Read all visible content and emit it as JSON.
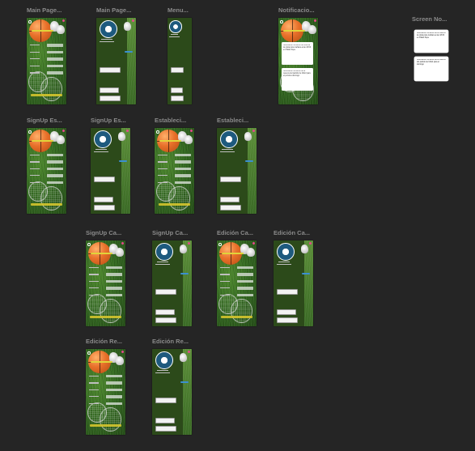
{
  "canvas": {
    "background": "#252525"
  },
  "frames": [
    {
      "title": "Main Page...",
      "variant": "hero"
    },
    {
      "title": "Main Page...",
      "variant": "profile"
    },
    {
      "title": "Menu...",
      "variant": "menu"
    },
    {
      "title": "Notificacio...",
      "variant": "notifications",
      "cards": [
        "Notificación recuerdo de reserva de pista para mañana a las 18:00 en Pádel Pepe",
        "Notificación recuerdo de la reserva del partido de fútbol para el próximo domingo"
      ]
    },
    {
      "title": "Screen No...",
      "variant": "notes",
      "notes": [
        "Notificación recuerdo de la reserva de pista para mañana a las 18:00 en Pádel Pepe",
        "Notificación recuerdo de la reserva del partido de fútbol para el domingo"
      ]
    },
    {
      "title": "SignUp Es...",
      "variant": "hero"
    },
    {
      "title": "SignUp Es...",
      "variant": "profile"
    },
    {
      "title": "Estableci...",
      "variant": "hero"
    },
    {
      "title": "Estableci...",
      "variant": "profile"
    },
    {
      "title": "SignUp Ca...",
      "variant": "hero"
    },
    {
      "title": "SignUp Ca...",
      "variant": "profile"
    },
    {
      "title": "Edición Ca...",
      "variant": "hero"
    },
    {
      "title": "Edición Ca...",
      "variant": "profile"
    },
    {
      "title": "Edición Re...",
      "variant": "hero"
    },
    {
      "title": "Edición Re...",
      "variant": "profile"
    }
  ],
  "colors": {
    "accent_yellow": "#e0d43a",
    "field_green": "#2f5e1f",
    "ball_orange": "#e8702a",
    "title_grey": "#8a8a8a"
  },
  "icons": {
    "profile": "avatar-icon",
    "ball": "basketball-icon",
    "shoes": "sneakers-icon",
    "racket": "tennis-racket-icon"
  }
}
